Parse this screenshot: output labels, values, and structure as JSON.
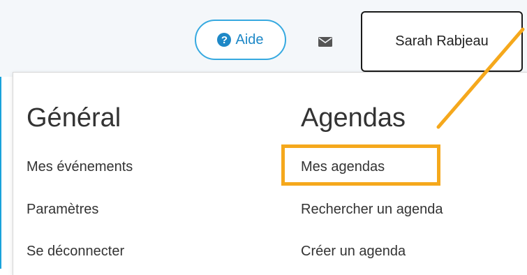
{
  "header": {
    "help_label": "Aide",
    "help_icon": "question-circle-icon",
    "mail_icon": "envelope-icon",
    "user_name": "Sarah Rabjeau"
  },
  "menu": {
    "general": {
      "title": "Général",
      "items": [
        "Mes événements",
        "Paramètres",
        "Se déconnecter"
      ]
    },
    "agendas": {
      "title": "Agendas",
      "items": [
        "Mes agendas",
        "Rechercher un agenda",
        "Créer un agenda"
      ]
    }
  },
  "annotation": {
    "highlighted_item": "Mes agendas",
    "color": "#f5a81c"
  },
  "colors": {
    "accent": "#1e88c7",
    "frame": "#1aa3db"
  }
}
